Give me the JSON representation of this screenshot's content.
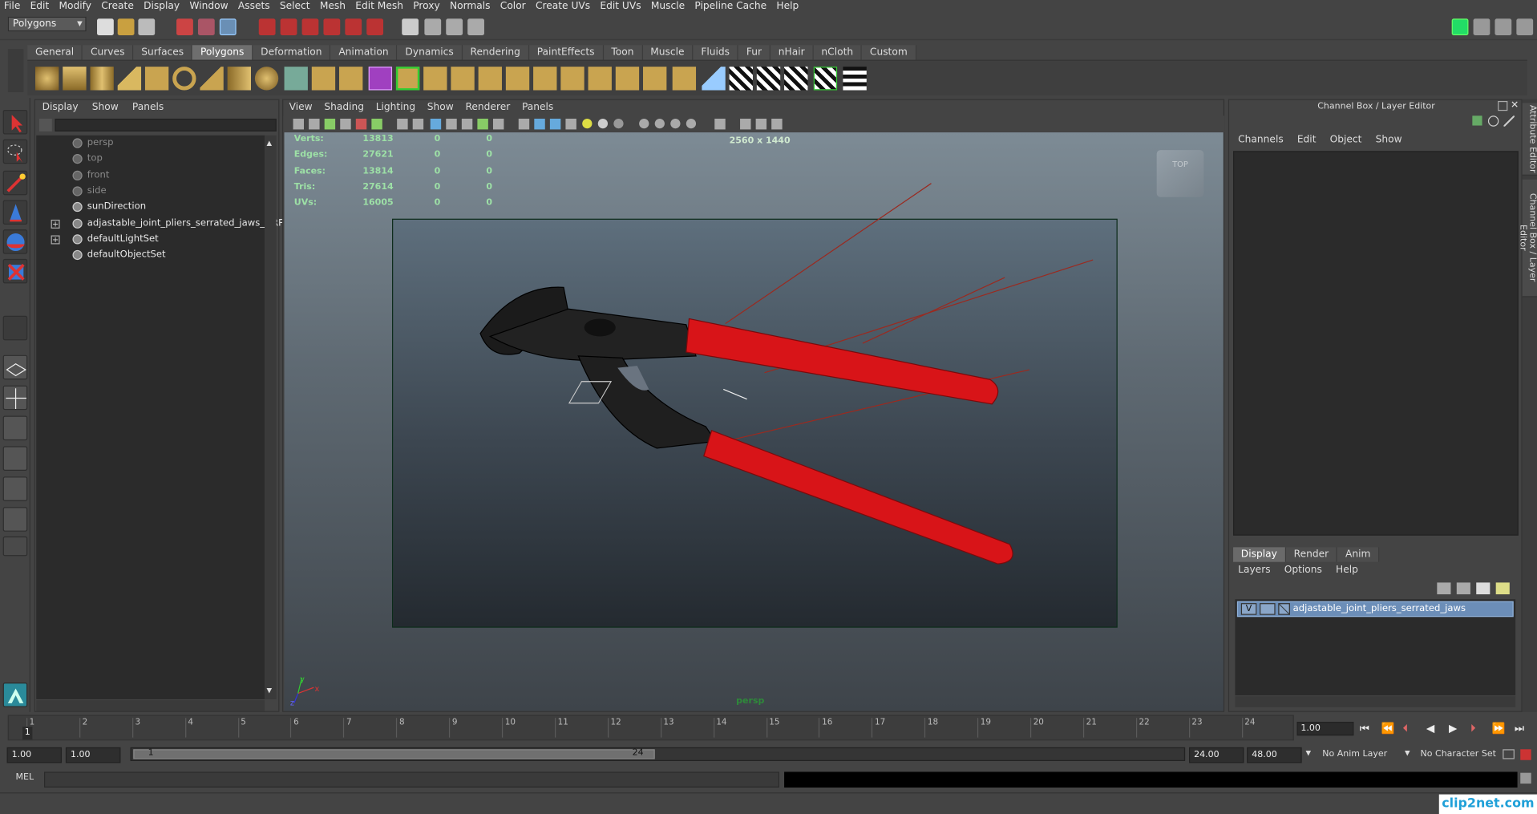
{
  "menubar": {
    "items": [
      "File",
      "Edit",
      "Modify",
      "Create",
      "Display",
      "Window",
      "Assets",
      "Select",
      "Mesh",
      "Edit Mesh",
      "Proxy",
      "Normals",
      "Color",
      "Create UVs",
      "Edit UVs",
      "Muscle",
      "Pipeline Cache",
      "Help"
    ]
  },
  "statusline": {
    "mode": "Polygons"
  },
  "shelf": {
    "tabs": [
      "General",
      "Curves",
      "Surfaces",
      "Polygons",
      "Deformation",
      "Animation",
      "Dynamics",
      "Rendering",
      "PaintEffects",
      "Toon",
      "Muscle",
      "Fluids",
      "Fur",
      "nHair",
      "nCloth",
      "Custom"
    ],
    "active_tab": "Polygons"
  },
  "outliner": {
    "menu": [
      "Display",
      "Show",
      "Panels"
    ],
    "items": [
      {
        "label": "persp",
        "dim": true,
        "expand": false
      },
      {
        "label": "top",
        "dim": true,
        "expand": false
      },
      {
        "label": "front",
        "dim": true,
        "expand": false
      },
      {
        "label": "side",
        "dim": true,
        "expand": false
      },
      {
        "label": "sunDirection",
        "dim": false,
        "expand": false
      },
      {
        "label": "adjastable_joint_pliers_serrated_jaws_GRP",
        "dim": false,
        "expand": true
      },
      {
        "label": "defaultLightSet",
        "dim": false,
        "expand": true
      },
      {
        "label": "defaultObjectSet",
        "dim": false,
        "expand": false
      }
    ]
  },
  "viewport": {
    "menu": [
      "View",
      "Shading",
      "Lighting",
      "Show",
      "Renderer",
      "Panels"
    ],
    "hud": {
      "rows": [
        {
          "label": "Verts:",
          "v1": "13813",
          "v2": "0",
          "v3": "0"
        },
        {
          "label": "Edges:",
          "v1": "27621",
          "v2": "0",
          "v3": "0"
        },
        {
          "label": "Faces:",
          "v1": "13814",
          "v2": "0",
          "v3": "0"
        },
        {
          "label": "Tris:",
          "v1": "27614",
          "v2": "0",
          "v3": "0"
        },
        {
          "label": "UVs:",
          "v1": "16005",
          "v2": "0",
          "v3": "0"
        }
      ],
      "resolution": "2560 x 1440",
      "camera": "persp"
    },
    "viewcube_label": "TOP"
  },
  "channelbox": {
    "title": "Channel Box / Layer Editor",
    "menu": [
      "Channels",
      "Edit",
      "Object",
      "Show"
    ]
  },
  "layereditor": {
    "tabs": [
      "Display",
      "Render",
      "Anim"
    ],
    "active_tab": "Display",
    "menu": [
      "Layers",
      "Options",
      "Help"
    ],
    "layer": {
      "visible": "V",
      "name": "adjastable_joint_pliers_serrated_jaws"
    }
  },
  "side_tabs": [
    "Attribute Editor",
    "Channel Box / Layer Editor"
  ],
  "timeline": {
    "ticks": [
      "1",
      "2",
      "3",
      "4",
      "5",
      "6",
      "7",
      "8",
      "9",
      "10",
      "11",
      "12",
      "13",
      "14",
      "15",
      "16",
      "17",
      "18",
      "19",
      "20",
      "21",
      "22",
      "23",
      "24"
    ],
    "current_frame": "1.00",
    "current_marker": "1"
  },
  "range": {
    "start_time": "1.00",
    "start_range": "1.00",
    "range_start_label": "1",
    "range_end_label": "24",
    "end_range": "24.00",
    "end_time": "48.00",
    "anim_layer": "No Anim Layer",
    "character_set": "No Character Set"
  },
  "cmdline": {
    "label": "MEL"
  },
  "watermark": "clip2net.com",
  "colors": {
    "accent_red": "#d81418",
    "hud_green": "#9de0a6",
    "selected_layer": "#6c8eb8"
  }
}
